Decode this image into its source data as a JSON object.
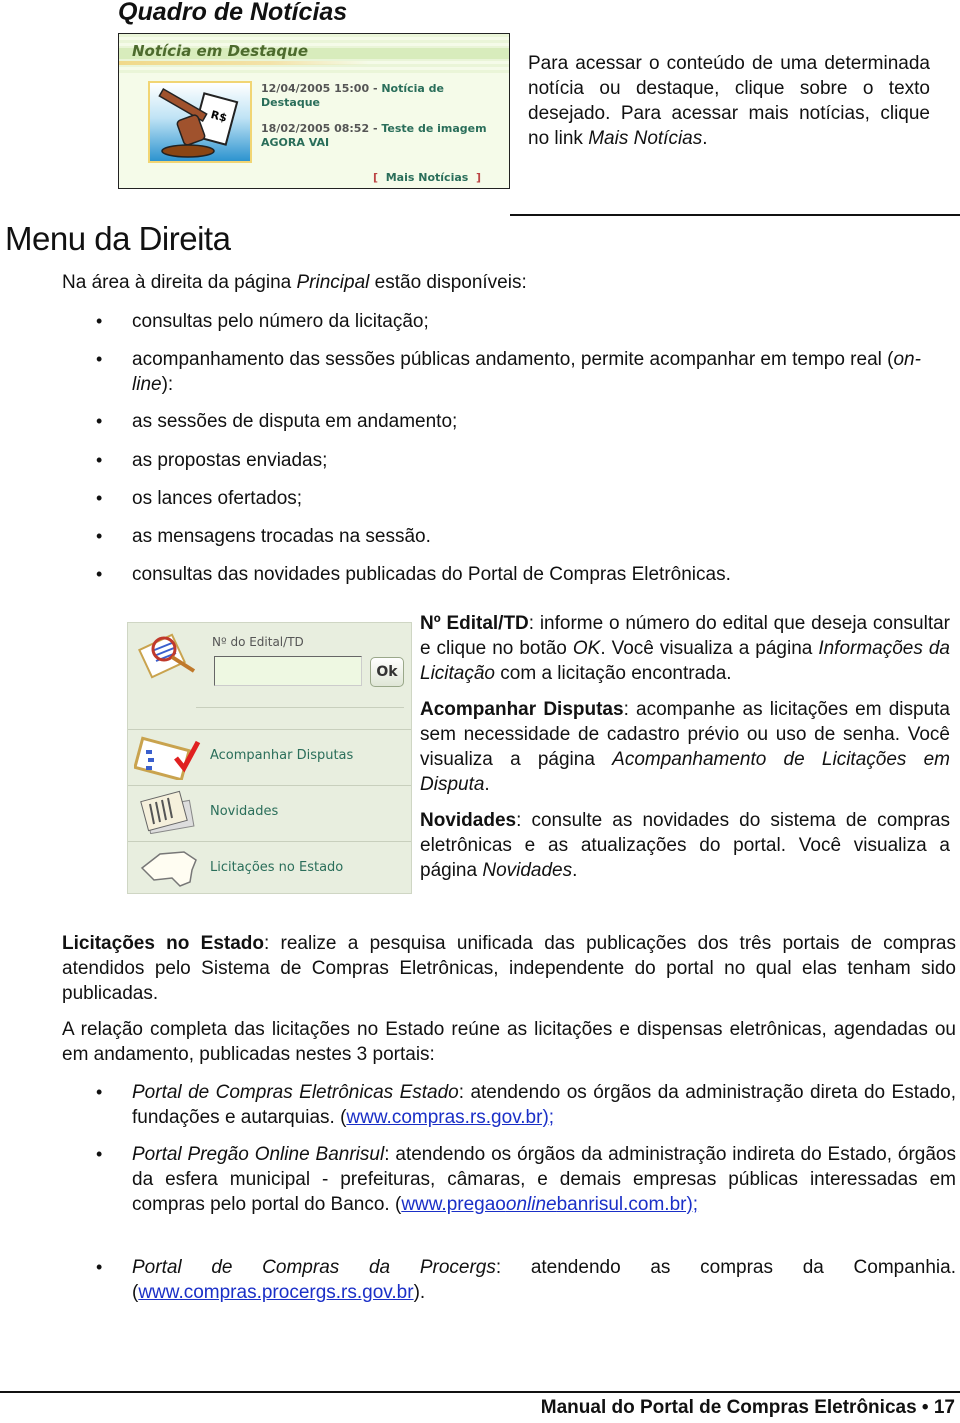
{
  "quadro": {
    "heading": "Quadro de Notícias",
    "box_title": "Notícia em Destaque",
    "items": [
      {
        "date": "12/04/2005 15:00",
        "sep": " - ",
        "title": "Notícia de Destaque"
      },
      {
        "date": "18/02/2005 08:52",
        "sep": " - ",
        "title": "Teste de imagem AGORA VAI"
      }
    ],
    "more_link": "Mais Notícias",
    "description": {
      "text": "Para acessar o conteúdo de uma determinada notícia ou destaque, clique sobre o texto desejado. Para acessar mais notícias, clique no link ",
      "em": "Mais Notícias",
      "end": "."
    }
  },
  "menu": {
    "heading": "Menu da Direita",
    "intro_pre": "Na área à direita da página ",
    "intro_em": "Principal",
    "intro_post": " estão disponíveis:",
    "bullets": [
      "consultas pelo número da licitação;",
      "acompanhamento das sessões públicas andamento, permite acompanhar em tempo real (",
      "as sessões de disputa em andamento;",
      "as propostas enviadas;",
      "os lances ofertados;",
      "as mensagens trocadas na sessão.",
      "consultas das novidades publicadas do Portal de Compras Eletrônicas."
    ],
    "bullet2_em": "on-line",
    "bullet2_end": "):"
  },
  "widget": {
    "edital_label": "Nº do Edital/TD",
    "edital_value": "",
    "ok_label": "Ok",
    "items": [
      "Acompanhar Disputas",
      "Novidades",
      "Licitações no Estado"
    ]
  },
  "descriptions": {
    "edital": {
      "bold": "Nº Edital/TD",
      "t1": ": informe o número do edital que deseja consultar e clique no botão ",
      "em1": "OK",
      "t2": ". Você visualiza a página ",
      "em2": "Informações da Licitação",
      "t3": " com a licitação encontrada."
    },
    "disputas": {
      "bold": "Acompanhar Disputas",
      "t1": ": acompanhe as licitações em disputa sem necessidade de cadastro prévio ou uso de senha. Você visualiza a página ",
      "em1": "Acompanhamento de Licitações em Disputa",
      "t2": "."
    },
    "novidades": {
      "bold": "Novidades",
      "t1": ": consulte as novidades do sistema de compras eletrônicas e as atualizações do portal. Você visualiza a página ",
      "em1": "Novidades",
      "t2": "."
    },
    "estado": {
      "bold": "Licitações no Estado",
      "t1": ": realize a pesquisa unificada das publicações dos três portais de compras atendidos pelo Sistema de Compras Eletrônicas, independente do portal no qual elas tenham sido publicadas."
    },
    "relacao": "A relação completa das licitações no Estado reúne as licitações e dispensas eletrônicas, agendadas ou em andamento, publicadas nestes 3 portais:"
  },
  "portals": [
    {
      "name": "Portal de Compras Eletrônicas Estado",
      "text": ": atendendo os órgãos da administração direta do Estado, fundações e autarquias. (",
      "link": "www.compras.rs.gov.br);",
      "end": ""
    },
    {
      "name": "Portal Pregão Online Banrisul",
      "text": ": atendendo os órgãos da administração indireta do Estado, órgãos da esfera municipal - prefeituras, câmaras, e demais empresas públicas interessadas em compras pelo portal do Banco. (",
      "link_a": "www.pregao",
      "link_em": "online",
      "link_b": "banrisul.com.br);",
      "end": ""
    },
    {
      "name": "Portal de Compras da Procergs",
      "text": ": atendendo as compras da Companhia. (",
      "link": "www.compras.procergs.rs.gov.br",
      "end": ")."
    }
  ],
  "footer": "Manual do Portal de Compras Eletrônicas • 17"
}
